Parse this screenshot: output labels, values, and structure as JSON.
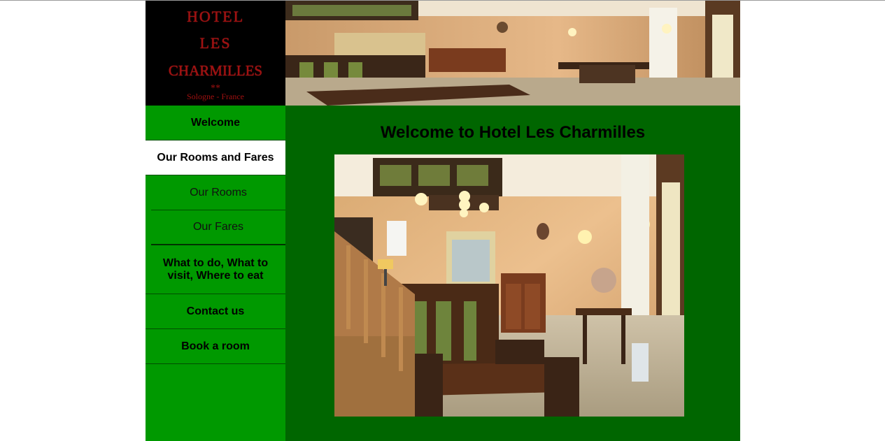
{
  "logo": {
    "line1": "HOTEL",
    "line2": "LES",
    "line3": "CHARMILLES",
    "stars": "**",
    "tagline": "Sologne - France"
  },
  "nav": [
    {
      "label": "Welcome"
    },
    {
      "label": "Our Rooms and Fares"
    },
    {
      "label": "Our Rooms"
    },
    {
      "label": "Our Fares"
    },
    {
      "label": "What to do, What to visit, Where to eat"
    },
    {
      "label": "Contact us"
    },
    {
      "label": "Book a room"
    }
  ],
  "main": {
    "title": "Welcome to Hotel Les Charmilles"
  },
  "colors": {
    "sidebar": "#009900",
    "main": "#006600",
    "logo_bg": "#000000",
    "logo_text": "#a01010"
  }
}
